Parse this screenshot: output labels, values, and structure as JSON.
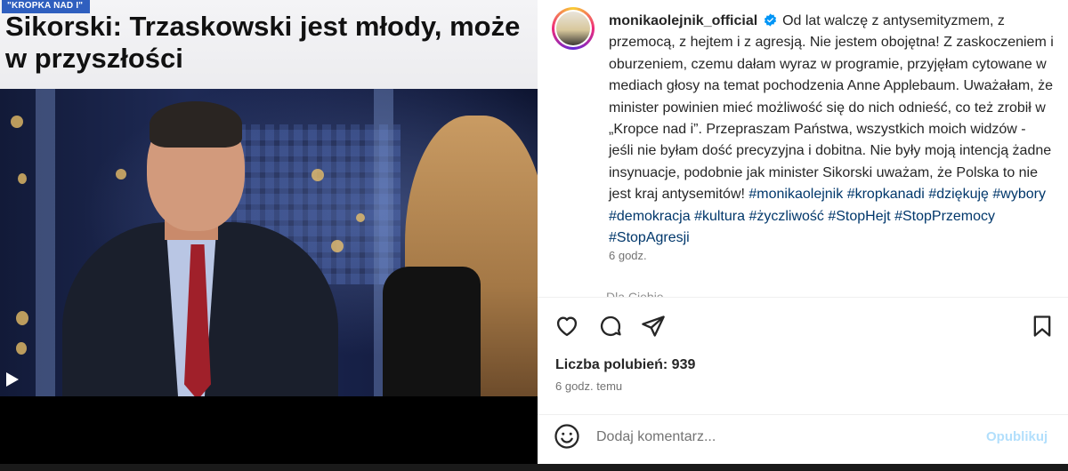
{
  "media": {
    "program_tag": "\"KROPKA NAD I\"",
    "headline": "Sikorski: Trzaskowski jest młody, może w przyszłości",
    "play_icon": "play-icon"
  },
  "post": {
    "username": "monikaolejnik_official",
    "verified_icon": "verified-badge-icon",
    "caption_text": "Od lat walczę z antysemityzmem, z przemocą, z hejtem i z agresją. Nie jestem obojętna! Z zaskoczeniem i oburzeniem, czemu dałam wyraz w programie, przyjęłam cytowane w mediach głosy na temat pochodzenia Anne Applebaum. Uważałam, że minister powinien mieć możliwość się do nich odnieść, co też zrobił w „Kropce nad i”. Przepraszam Państwa, wszystkich moich widzów - jeśli nie byłam dość precyzyjna i dobitna. Nie były moją intencją żadne insynuacje, podobnie jak minister Sikorski uważam, że Polska to nie jest kraj antysemitów!",
    "hashtags": [
      "#monikaolejnik",
      "#kropkanadi",
      "#dziękuję",
      "#wybory",
      "#demokracja",
      "#kultura",
      "#życzliwość",
      "#StopHejt",
      "#StopPrzemocy",
      "#StopAgresji"
    ],
    "time_short": "6 godz.",
    "for_you": "Dla Ciebie ⌄",
    "likes_text": "Liczba polubień: 939",
    "time_full": "6 godz. temu",
    "comment_placeholder": "Dodaj komentarz...",
    "publish_label": "Opublikuj",
    "icons": [
      "heart-icon",
      "comment-icon",
      "share-icon",
      "bookmark-icon",
      "emoji-icon"
    ],
    "colors": {
      "hashtag": "#00376b",
      "publish_disabled": "#b2dffc",
      "tag_bg": "#2f5fbf"
    }
  }
}
